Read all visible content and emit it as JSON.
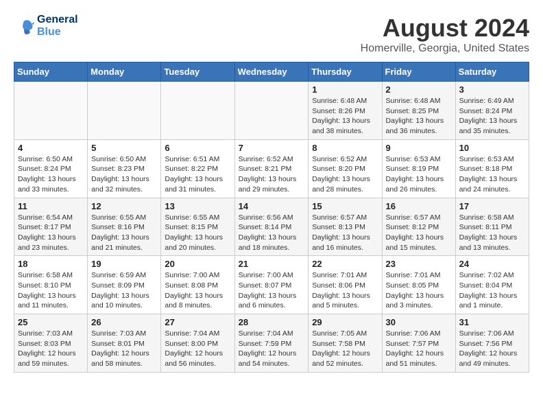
{
  "header": {
    "logo_line1": "General",
    "logo_line2": "Blue",
    "month": "August 2024",
    "location": "Homerville, Georgia, United States"
  },
  "weekdays": [
    "Sunday",
    "Monday",
    "Tuesday",
    "Wednesday",
    "Thursday",
    "Friday",
    "Saturday"
  ],
  "weeks": [
    [
      {
        "day": "",
        "info": ""
      },
      {
        "day": "",
        "info": ""
      },
      {
        "day": "",
        "info": ""
      },
      {
        "day": "",
        "info": ""
      },
      {
        "day": "1",
        "info": "Sunrise: 6:48 AM\nSunset: 8:26 PM\nDaylight: 13 hours\nand 38 minutes."
      },
      {
        "day": "2",
        "info": "Sunrise: 6:48 AM\nSunset: 8:25 PM\nDaylight: 13 hours\nand 36 minutes."
      },
      {
        "day": "3",
        "info": "Sunrise: 6:49 AM\nSunset: 8:24 PM\nDaylight: 13 hours\nand 35 minutes."
      }
    ],
    [
      {
        "day": "4",
        "info": "Sunrise: 6:50 AM\nSunset: 8:24 PM\nDaylight: 13 hours\nand 33 minutes."
      },
      {
        "day": "5",
        "info": "Sunrise: 6:50 AM\nSunset: 8:23 PM\nDaylight: 13 hours\nand 32 minutes."
      },
      {
        "day": "6",
        "info": "Sunrise: 6:51 AM\nSunset: 8:22 PM\nDaylight: 13 hours\nand 31 minutes."
      },
      {
        "day": "7",
        "info": "Sunrise: 6:52 AM\nSunset: 8:21 PM\nDaylight: 13 hours\nand 29 minutes."
      },
      {
        "day": "8",
        "info": "Sunrise: 6:52 AM\nSunset: 8:20 PM\nDaylight: 13 hours\nand 28 minutes."
      },
      {
        "day": "9",
        "info": "Sunrise: 6:53 AM\nSunset: 8:19 PM\nDaylight: 13 hours\nand 26 minutes."
      },
      {
        "day": "10",
        "info": "Sunrise: 6:53 AM\nSunset: 8:18 PM\nDaylight: 13 hours\nand 24 minutes."
      }
    ],
    [
      {
        "day": "11",
        "info": "Sunrise: 6:54 AM\nSunset: 8:17 PM\nDaylight: 13 hours\nand 23 minutes."
      },
      {
        "day": "12",
        "info": "Sunrise: 6:55 AM\nSunset: 8:16 PM\nDaylight: 13 hours\nand 21 minutes."
      },
      {
        "day": "13",
        "info": "Sunrise: 6:55 AM\nSunset: 8:15 PM\nDaylight: 13 hours\nand 20 minutes."
      },
      {
        "day": "14",
        "info": "Sunrise: 6:56 AM\nSunset: 8:14 PM\nDaylight: 13 hours\nand 18 minutes."
      },
      {
        "day": "15",
        "info": "Sunrise: 6:57 AM\nSunset: 8:13 PM\nDaylight: 13 hours\nand 16 minutes."
      },
      {
        "day": "16",
        "info": "Sunrise: 6:57 AM\nSunset: 8:12 PM\nDaylight: 13 hours\nand 15 minutes."
      },
      {
        "day": "17",
        "info": "Sunrise: 6:58 AM\nSunset: 8:11 PM\nDaylight: 13 hours\nand 13 minutes."
      }
    ],
    [
      {
        "day": "18",
        "info": "Sunrise: 6:58 AM\nSunset: 8:10 PM\nDaylight: 13 hours\nand 11 minutes."
      },
      {
        "day": "19",
        "info": "Sunrise: 6:59 AM\nSunset: 8:09 PM\nDaylight: 13 hours\nand 10 minutes."
      },
      {
        "day": "20",
        "info": "Sunrise: 7:00 AM\nSunset: 8:08 PM\nDaylight: 13 hours\nand 8 minutes."
      },
      {
        "day": "21",
        "info": "Sunrise: 7:00 AM\nSunset: 8:07 PM\nDaylight: 13 hours\nand 6 minutes."
      },
      {
        "day": "22",
        "info": "Sunrise: 7:01 AM\nSunset: 8:06 PM\nDaylight: 13 hours\nand 5 minutes."
      },
      {
        "day": "23",
        "info": "Sunrise: 7:01 AM\nSunset: 8:05 PM\nDaylight: 13 hours\nand 3 minutes."
      },
      {
        "day": "24",
        "info": "Sunrise: 7:02 AM\nSunset: 8:04 PM\nDaylight: 13 hours\nand 1 minute."
      }
    ],
    [
      {
        "day": "25",
        "info": "Sunrise: 7:03 AM\nSunset: 8:03 PM\nDaylight: 12 hours\nand 59 minutes."
      },
      {
        "day": "26",
        "info": "Sunrise: 7:03 AM\nSunset: 8:01 PM\nDaylight: 12 hours\nand 58 minutes."
      },
      {
        "day": "27",
        "info": "Sunrise: 7:04 AM\nSunset: 8:00 PM\nDaylight: 12 hours\nand 56 minutes."
      },
      {
        "day": "28",
        "info": "Sunrise: 7:04 AM\nSunset: 7:59 PM\nDaylight: 12 hours\nand 54 minutes."
      },
      {
        "day": "29",
        "info": "Sunrise: 7:05 AM\nSunset: 7:58 PM\nDaylight: 12 hours\nand 52 minutes."
      },
      {
        "day": "30",
        "info": "Sunrise: 7:06 AM\nSunset: 7:57 PM\nDaylight: 12 hours\nand 51 minutes."
      },
      {
        "day": "31",
        "info": "Sunrise: 7:06 AM\nSunset: 7:56 PM\nDaylight: 12 hours\nand 49 minutes."
      }
    ]
  ]
}
